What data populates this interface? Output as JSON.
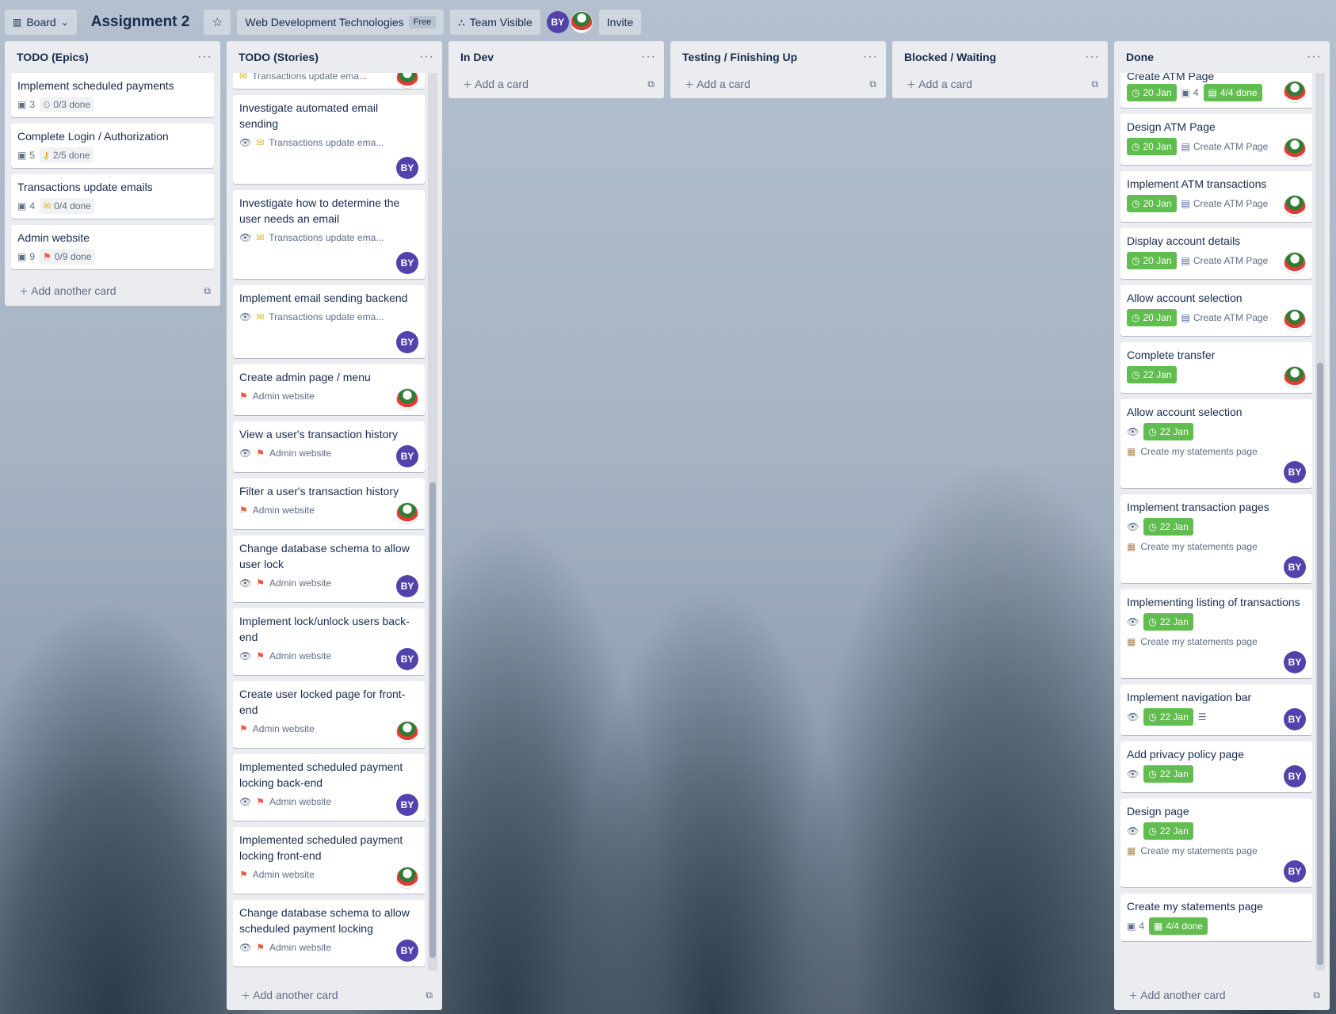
{
  "topbar": {
    "board_button": "Board",
    "board_title": "Assignment 2",
    "workspace": "Web Development Technologies",
    "plan": "Free",
    "visibility": "Team Visible",
    "avatar_initials": "BY",
    "invite": "Invite"
  },
  "lists": {
    "epics": {
      "title": "TODO (Epics)",
      "add_label": "Add another card",
      "cards": [
        {
          "title": "Implement scheduled payments",
          "count": "3",
          "progress": "0/3 done"
        },
        {
          "title": "Complete Login / Authorization",
          "count": "5",
          "progress": "2/5 done"
        },
        {
          "title": "Transactions update emails",
          "count": "4",
          "progress": "0/4 done"
        },
        {
          "title": "Admin website",
          "count": "9",
          "progress": "0/9 done"
        }
      ]
    },
    "stories": {
      "title": "TODO (Stories)",
      "add_label": "Add another card",
      "partial_card_epic": "Transactions update ema...",
      "cards": [
        {
          "title": "Investigate automated email sending",
          "epic": "Transactions update ema...",
          "avatar": "BY"
        },
        {
          "title": "Investigate how to determine the user needs an email",
          "epic": "Transactions update ema...",
          "avatar": "BY"
        },
        {
          "title": "Implement email sending backend",
          "epic": "Transactions update ema...",
          "avatar": "BY"
        },
        {
          "title": "Create admin page / menu",
          "epic": "Admin website",
          "avatar": ""
        },
        {
          "title": "View a user's transaction history",
          "epic": "Admin website",
          "avatar": "BY"
        },
        {
          "title": "Filter a user's transaction history",
          "epic": "Admin website",
          "avatar": ""
        },
        {
          "title": "Change database schema to allow user lock",
          "epic": "Admin website",
          "avatar": "BY"
        },
        {
          "title": "Implement lock/unlock users back-end",
          "epic": "Admin website",
          "avatar": "BY"
        },
        {
          "title": "Create user locked page for front-end",
          "epic": "Admin website",
          "avatar": ""
        },
        {
          "title": "Implemented scheduled payment locking back-end",
          "epic": "Admin website",
          "avatar": "BY"
        },
        {
          "title": "Implemented scheduled payment locking front-end",
          "epic": "Admin website",
          "avatar": ""
        },
        {
          "title": "Change database schema to allow scheduled payment locking",
          "epic": "Admin website",
          "avatar": "BY"
        }
      ]
    },
    "indev": {
      "title": "In Dev",
      "add_label": "Add a card"
    },
    "testing": {
      "title": "Testing / Finishing Up",
      "add_label": "Add a card"
    },
    "blocked": {
      "title": "Blocked / Waiting",
      "add_label": "Add a card"
    },
    "done": {
      "title": "Done",
      "add_label": "Add another card",
      "cards": [
        {
          "title": "Create ATM Page",
          "date": "20 Jan",
          "count": "4",
          "progress": "4/4 done"
        },
        {
          "title": "Design ATM Page",
          "date": "20 Jan",
          "epic": "Create ATM Page"
        },
        {
          "title": "Implement ATM transactions",
          "date": "20 Jan",
          "epic": "Create ATM Page"
        },
        {
          "title": "Display account details",
          "date": "20 Jan",
          "epic": "Create ATM Page"
        },
        {
          "title": "Allow account selection",
          "date": "20 Jan",
          "epic": "Create ATM Page"
        },
        {
          "title": "Complete transfer",
          "date": "22 Jan"
        },
        {
          "title": "Allow account selection",
          "date": "22 Jan",
          "epic": "Create my statements page",
          "avatar": "BY"
        },
        {
          "title": "Implement transaction pages",
          "date": "22 Jan",
          "epic": "Create my statements page",
          "avatar": "BY"
        },
        {
          "title": "Implementing listing of transactions",
          "date": "22 Jan",
          "epic": "Create my statements page",
          "avatar": "BY"
        },
        {
          "title": "Implement navigation bar",
          "date": "22 Jan",
          "avatar": "BY"
        },
        {
          "title": "Add privacy policy page",
          "date": "22 Jan",
          "avatar": "BY"
        },
        {
          "title": "Design page",
          "date": "22 Jan",
          "epic": "Create my statements page",
          "avatar": "BY"
        },
        {
          "title": "Create my statements page",
          "count": "4",
          "progress": "4/4 done"
        }
      ]
    }
  },
  "colors": {
    "done_green": "#61bd4f",
    "avatar_purple": "#5243aa",
    "flag_red": "#eb5a46"
  }
}
